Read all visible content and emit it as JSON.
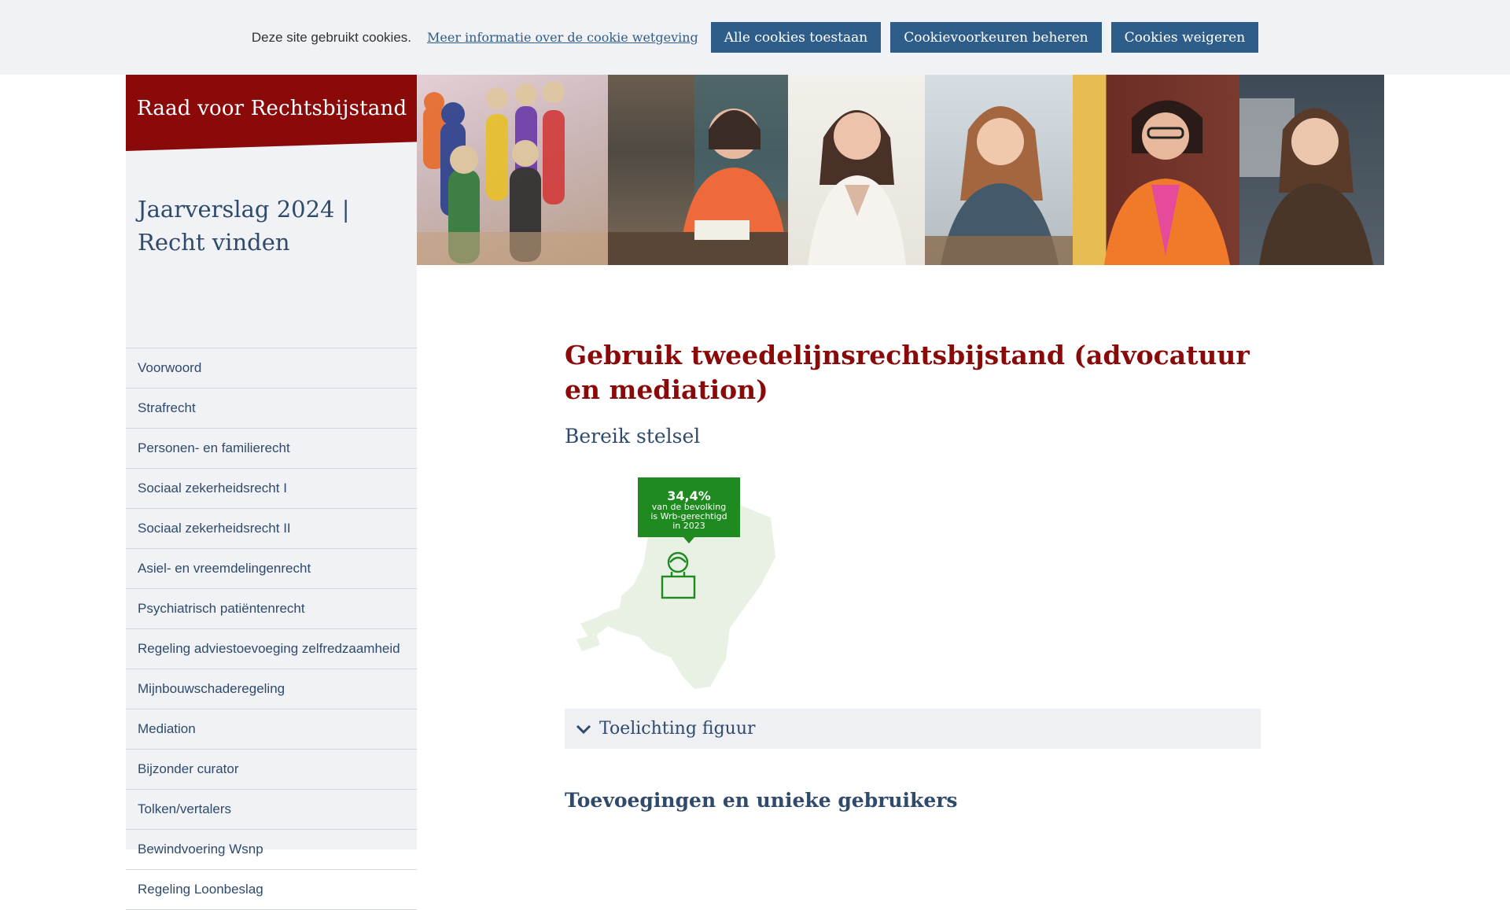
{
  "cookie_bar": {
    "text": "Deze site gebruikt cookies.",
    "link": "Meer informatie over de cookie wetgeving",
    "buttons": [
      "Alle cookies toestaan",
      "Cookievoorkeuren beheren",
      "Cookies weigeren"
    ]
  },
  "site": {
    "logo": "Raad voor Rechtsbijstand",
    "report_title": "Jaarverslag 2024 | Recht vinden"
  },
  "nav": [
    "Voorwoord",
    "Strafrecht",
    "Personen- en familierecht",
    "Sociaal zekerheidsrecht I",
    "Sociaal zekerheidsrecht II",
    "Asiel- en vreemdelingenrecht",
    "Psychiatrisch patiëntenrecht",
    "Regeling adviestoevoeging zelfredzaamheid",
    "Mijnbouwschaderegeling",
    "Mediation",
    "Bijzonder curator",
    "Tolken/vertalers",
    "Bewindvoering Wsnp",
    "Regeling Loonbeslag"
  ],
  "content": {
    "heading": "Gebruik tweedelijnsrechtsbijstand (advocatuur en mediation)",
    "subheading": "Bereik stelsel",
    "figure": {
      "percentage": "34,4%",
      "line1": "van de bevolking",
      "line2": "is Wrb-gerechtigd",
      "line3": "in 2023"
    },
    "accordion_label": "Toelichting figuur",
    "next_heading": "Toevoegingen en unieke gebruikers"
  },
  "colors": {
    "brand_red": "#8a0a0a",
    "button_blue": "#2f5d8a",
    "text_blue": "#2f4a6b",
    "callout_green": "#1f8a1f"
  }
}
